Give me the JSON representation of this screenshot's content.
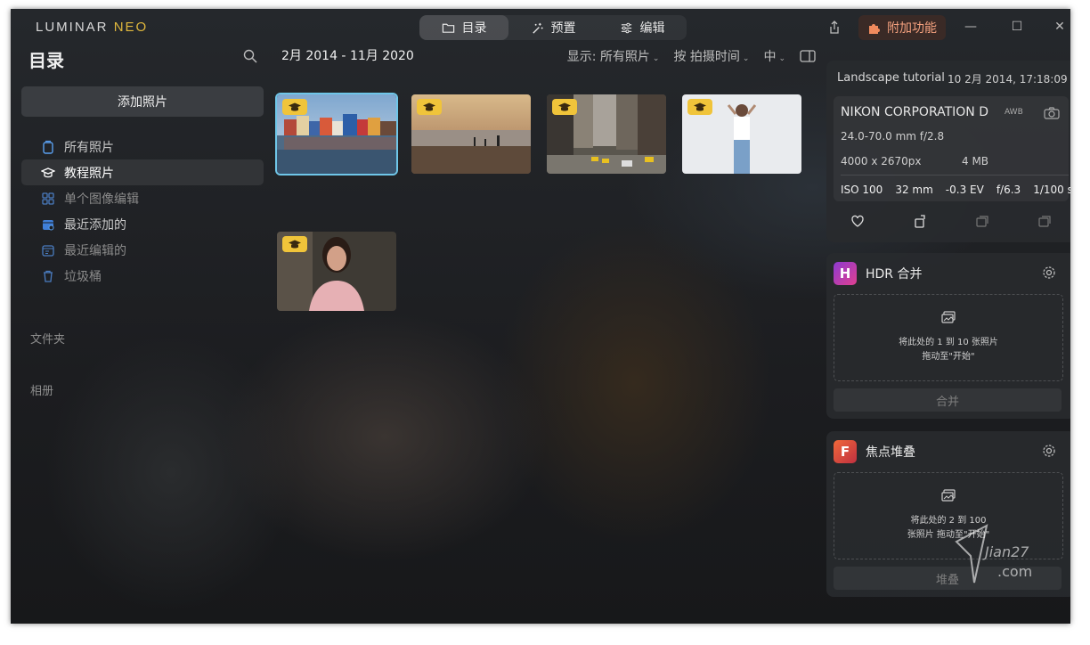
{
  "app": {
    "logo_main": "LUMINAR ",
    "logo_accent": "NEO"
  },
  "modes": [
    {
      "label": "目录",
      "icon": "folder-icon",
      "active": true
    },
    {
      "label": "预置",
      "icon": "magic-wand-icon",
      "active": false
    },
    {
      "label": "编辑",
      "icon": "sliders-icon",
      "active": false
    }
  ],
  "header": {
    "addons_label": "附加功能"
  },
  "sidebar": {
    "title": "目录",
    "add_photos": "添加照片",
    "items": [
      {
        "label": "所有照片",
        "icon": "photos-icon",
        "state": "normal"
      },
      {
        "label": "教程照片",
        "icon": "graduation-cap-icon",
        "state": "active"
      },
      {
        "label": "单个图像编辑",
        "icon": "grid-icon",
        "state": "dim"
      },
      {
        "label": "最近添加的",
        "icon": "calendar-add-icon",
        "state": "normal"
      },
      {
        "label": "最近编辑的",
        "icon": "calendar-edit-icon",
        "state": "dim"
      },
      {
        "label": "垃圾桶",
        "icon": "trash-icon",
        "state": "dim"
      }
    ],
    "folders_label": "文件夹",
    "albums_label": "相册"
  },
  "main": {
    "date_range": "2月 2014 - 11月 2020",
    "filters": {
      "show_label": "显示:",
      "show_value": "所有照片",
      "sort_value": "按 拍摄时间",
      "size_value": "中"
    }
  },
  "info": {
    "title": "Landscape tutorial",
    "date": "10 2月 2014, 17:18:09",
    "camera": "NIKON CORPORATION D",
    "awb": "AWB",
    "lens": "24.0-70.0 mm f/2.8",
    "resolution": "4000 x 2670px",
    "filesize": "4 MB",
    "exif": [
      "ISO 100",
      "32 mm",
      "-0.3 EV",
      "f/6.3",
      "1/100 s"
    ]
  },
  "extensions": [
    {
      "name": "HDR 合并",
      "letter": "H",
      "color": "#b03aa8",
      "drop_line1": "将此处的 1 到 10 张照片",
      "drop_line2": "拖动至\"开始\"",
      "button": "合并"
    },
    {
      "name": "焦点堆叠",
      "letter": "F",
      "color": "#d9583a",
      "drop_line1": "将此处的 2 到 100",
      "drop_line2": "张照片 拖动至\"开始\"",
      "button": "堆叠"
    }
  ],
  "watermark": {
    "line1": "Jian27",
    "line2": ".com"
  }
}
